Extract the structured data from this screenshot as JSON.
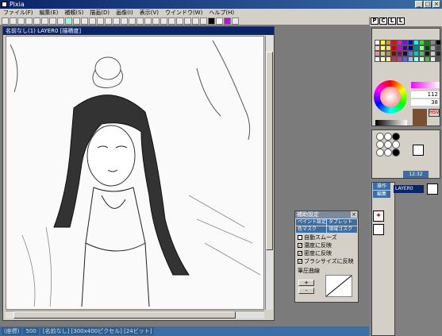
{
  "app": {
    "title": "Pixia"
  },
  "menu": [
    "ファイル(F)",
    "編集(E)",
    "補頼(S)",
    "描画(D)",
    "画像(I)",
    "表示(V)",
    "ウインドウ(W)",
    "ヘルプ(H)"
  ],
  "canvas_window": {
    "title": "名前なし(1) LAYER0 [描積度]"
  },
  "status_bar": [
    "(座標)",
    "500",
    "[名前なし] [300x400ピクセル] [24ビット]"
  ],
  "top_icons": [
    "P",
    "C",
    "L",
    "L"
  ],
  "colors": {
    "primary": "#ffffff",
    "secondary": "#000000",
    "accent": "#3a6ea5"
  },
  "color_values": {
    "value1": "112",
    "value2": "38",
    "box_label": "HSV"
  },
  "layer_panel": {
    "label1": "操作",
    "label2": "編集",
    "layer_name": "LAYER0"
  },
  "brush_dialog": {
    "title": "補助設定",
    "tabs": [
      "ペイント設定",
      "タブレット",
      "色マスク",
      "領域ゴスク"
    ],
    "checkboxes": [
      {
        "label": "自動スムーズ",
        "checked": false
      },
      {
        "label": "濃度に反映",
        "checked": true
      },
      {
        "label": "密度に反映",
        "checked": true
      },
      {
        "label": "ブラシサイズに反映",
        "checked": true
      }
    ],
    "curve_label": "筆圧曲線",
    "plus_label": "+",
    "minus_label": "-"
  },
  "size_display": "12:32"
}
